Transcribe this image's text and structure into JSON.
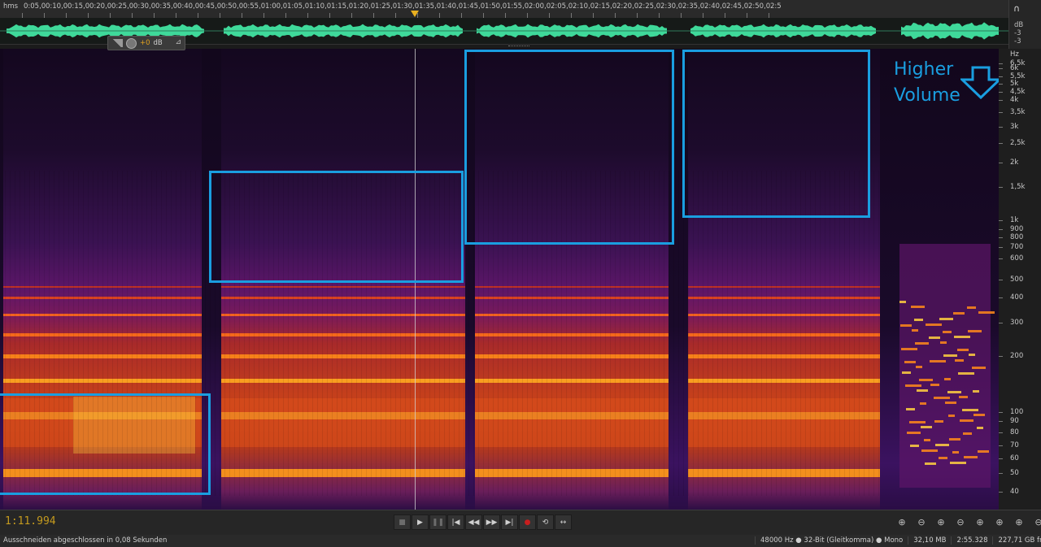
{
  "ruler": {
    "unit_label": "hms",
    "ticks": [
      "0:05,0",
      "0:10,0",
      "0:15,0",
      "0:20,0",
      "0:25,0",
      "0:30,0",
      "0:35,0",
      "0:40,0",
      "0:45,0",
      "0:50,0",
      "0:55,0",
      "1:00,0",
      "1:05,0",
      "1:10,0",
      "1:15,0",
      "1:20,0",
      "1:25,0",
      "1:30,0",
      "1:35,0",
      "1:40,0",
      "1:45,0",
      "1:50,0",
      "1:55,0",
      "2:00,0",
      "2:05,0",
      "2:10,0",
      "2:15,0",
      "2:20,0",
      "2:25,0",
      "2:30,0",
      "2:35,0",
      "2:40,0",
      "2:45,0",
      "2:50,0",
      "2:5"
    ]
  },
  "hud": {
    "value": "+0",
    "unit": "dB"
  },
  "db_strip": {
    "unit": "dB",
    "values": [
      "-3",
      "-3"
    ]
  },
  "hz_axis": {
    "unit": "Hz",
    "labels": [
      "6,5k",
      "6k",
      "5,5k",
      "5k",
      "4,5k",
      "4k",
      "3,5k",
      "3k",
      "2,5k",
      "2k",
      "1,5k",
      "1k",
      "900",
      "800",
      "700",
      "600",
      "500",
      "400",
      "300",
      "200",
      "100",
      "90",
      "80",
      "70",
      "60",
      "50",
      "40"
    ]
  },
  "annotation": {
    "text_line1": "Higher",
    "text_line2": "Volume",
    "color": "#1a9ee0"
  },
  "transport": {
    "time": "1:11.994",
    "buttons": [
      "stop",
      "play",
      "pause",
      "go-to-start",
      "rewind",
      "fast-forward",
      "go-to-end",
      "record",
      "loop",
      "skip-selection"
    ],
    "glyphs": [
      "■",
      "▶",
      "❚❚",
      "|◀",
      "◀◀",
      "▶▶",
      "▶|",
      "●",
      "⟲",
      "↔"
    ]
  },
  "zoom": {
    "glyphs": [
      "⊕",
      "⊖",
      "⊕",
      "⊖",
      "⊕",
      "⊕",
      "⊕",
      "⊖",
      "⊕"
    ]
  },
  "status": {
    "message": "Ausschneiden abgeschlossen in 0,08 Sekunden",
    "sample_format": "48000 Hz ● 32-Bit (Gleitkomma) ● Mono",
    "file_size": "32,10 MB",
    "duration": "2:55.328",
    "free_space": "227,71 GB frei"
  },
  "colors": {
    "waveform": "#3fd99a",
    "playhead_marker": "#e8b020",
    "timecode": "#c49a1e"
  }
}
